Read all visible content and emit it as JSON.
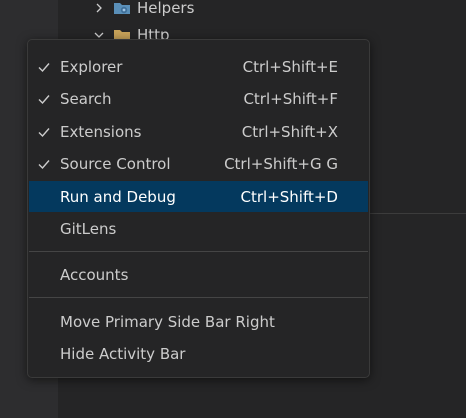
{
  "tree": {
    "items": [
      {
        "label": "Helpers",
        "chevron": "chevron-right-icon",
        "icon": "gear-folder-icon"
      },
      {
        "label": "Http",
        "chevron": "chevron-down-icon",
        "icon": "folder-icon"
      }
    ]
  },
  "context_menu": {
    "items": [
      {
        "label": "Explorer",
        "shortcut": "Ctrl+Shift+E",
        "checked": true
      },
      {
        "label": "Search",
        "shortcut": "Ctrl+Shift+F",
        "checked": true
      },
      {
        "label": "Extensions",
        "shortcut": "Ctrl+Shift+X",
        "checked": true
      },
      {
        "label": "Source Control",
        "shortcut": "Ctrl+Shift+G G",
        "checked": true
      },
      {
        "label": "Run and Debug",
        "shortcut": "Ctrl+Shift+D",
        "checked": false
      },
      {
        "label": "GitLens",
        "shortcut": "",
        "checked": false
      },
      {
        "label": "Accounts",
        "shortcut": "",
        "checked": false
      },
      {
        "label": "Move Primary Side Bar Right",
        "shortcut": "",
        "checked": false
      },
      {
        "label": "Hide Activity Bar",
        "shortcut": "",
        "checked": false
      }
    ]
  },
  "colors": {
    "highlight": "#04395e",
    "menu_background": "#252526",
    "text": "#cccccc"
  }
}
